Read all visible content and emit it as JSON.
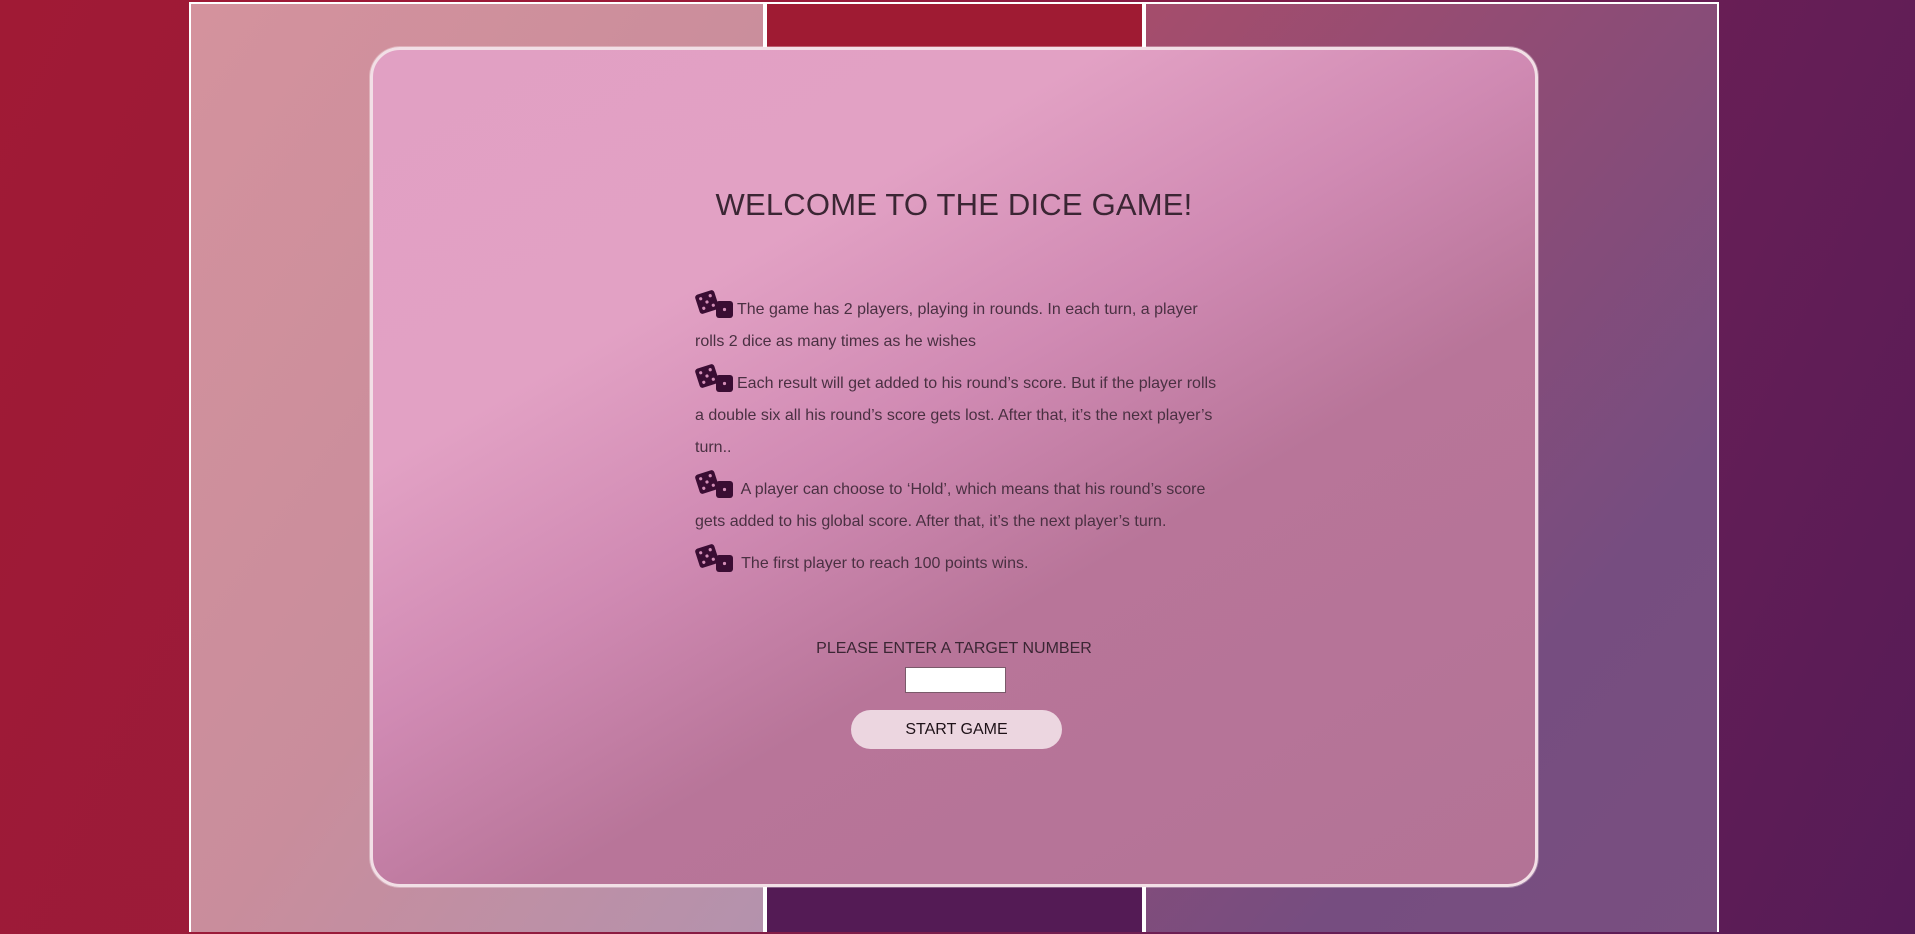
{
  "page": {
    "title": "WELCOME TO THE DICE GAME!"
  },
  "rules": [
    {
      "icon": "dice-icon",
      "text": "The game has 2 players, playing in rounds. In each turn, a player rolls 2 dice as many times as he wishes"
    },
    {
      "icon": "dice-icon",
      "text": "Each result will get added to his round’s score. But if the player rolls a double six all his round’s score gets lost. After that, it’s the next player’s turn.."
    },
    {
      "icon": "dice-icon",
      "text": " A player can choose to ‘Hold’, which means that his round’s score gets added to his global score. After that, it’s the next player’s turn."
    },
    {
      "icon": "dice-icon",
      "text": " The first player to reach 100 points wins."
    }
  ],
  "form": {
    "label": "PLEASE ENTER A TARGET NUMBER",
    "input_value": "",
    "input_placeholder": "",
    "start_label": "START GAME"
  },
  "colors": {
    "background_left": "#a01a35",
    "background_right": "#561b57",
    "modal_top": "#e1a0c3",
    "modal_bottom": "#b37396",
    "dice": "#3a0d33",
    "button": "#ecd6e0"
  }
}
